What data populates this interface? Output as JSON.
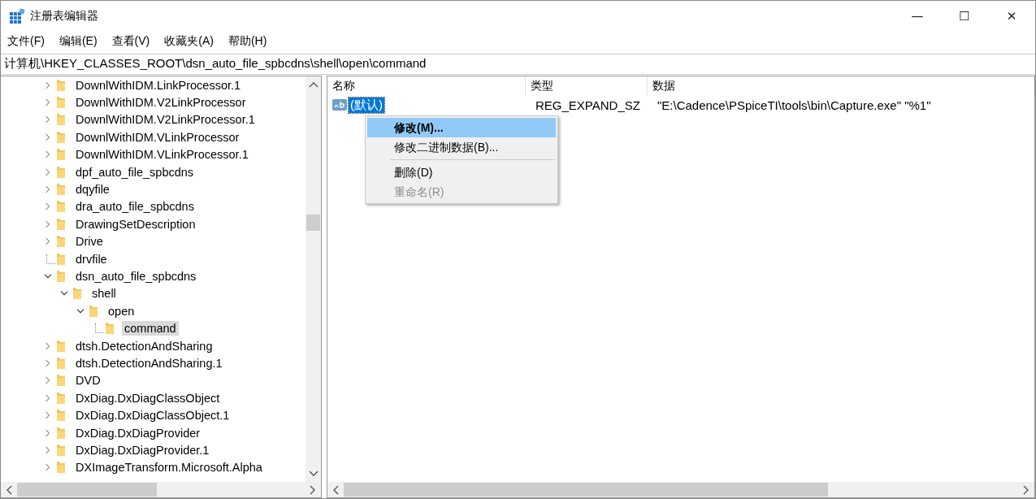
{
  "window": {
    "title": "注册表编辑器",
    "controls": [
      "—",
      "☐",
      "✕"
    ]
  },
  "menu": [
    "文件(F)",
    "编辑(E)",
    "查看(V)",
    "收藏夹(A)",
    "帮助(H)"
  ],
  "address": "计算机\\HKEY_CLASSES_ROOT\\dsn_auto_file_spbcdns\\shell\\open\\command",
  "tree": [
    {
      "label": "DownlWithIDM.LinkProcessor.1",
      "kind": "collapsed",
      "selected": false
    },
    {
      "label": "DownlWithIDM.V2LinkProcessor",
      "kind": "collapsed",
      "selected": false
    },
    {
      "label": "DownlWithIDM.V2LinkProcessor.1",
      "kind": "collapsed",
      "selected": false
    },
    {
      "label": "DownlWithIDM.VLinkProcessor",
      "kind": "collapsed",
      "selected": false
    },
    {
      "label": "DownlWithIDM.VLinkProcessor.1",
      "kind": "collapsed",
      "selected": false
    },
    {
      "label": "dpf_auto_file_spbcdns",
      "kind": "collapsed",
      "selected": false
    },
    {
      "label": "dqyfile",
      "kind": "collapsed",
      "selected": false
    },
    {
      "label": "dra_auto_file_spbcdns",
      "kind": "collapsed",
      "selected": false
    },
    {
      "label": "DrawingSetDescription",
      "kind": "collapsed",
      "selected": false
    },
    {
      "label": "Drive",
      "kind": "collapsed",
      "selected": false
    },
    {
      "label": "drvfile",
      "kind": "leaf",
      "selected": false
    },
    {
      "label": "dsn_auto_file_spbcdns",
      "kind": "expanded",
      "selected": false,
      "children": [
        {
          "label": "shell",
          "kind": "expanded",
          "selected": false,
          "children": [
            {
              "label": "open",
              "kind": "expanded",
              "selected": false,
              "children": [
                {
                  "label": "command",
                  "kind": "leaf",
                  "selected": true
                }
              ]
            }
          ]
        }
      ]
    },
    {
      "label": "dtsh.DetectionAndSharing",
      "kind": "collapsed",
      "selected": false
    },
    {
      "label": "dtsh.DetectionAndSharing.1",
      "kind": "collapsed",
      "selected": false
    },
    {
      "label": "DVD",
      "kind": "collapsed",
      "selected": false
    },
    {
      "label": "DxDiag.DxDiagClassObject",
      "kind": "collapsed",
      "selected": false
    },
    {
      "label": "DxDiag.DxDiagClassObject.1",
      "kind": "collapsed",
      "selected": false
    },
    {
      "label": "DxDiag.DxDiagProvider",
      "kind": "collapsed",
      "selected": false
    },
    {
      "label": "DxDiag.DxDiagProvider.1",
      "kind": "collapsed",
      "selected": false
    },
    {
      "label": "DXImageTransform.Microsoft.Alpha",
      "kind": "collapsed",
      "selected": false
    }
  ],
  "columns": [
    "名称",
    "类型",
    "数据"
  ],
  "values": [
    {
      "name": "(默认)",
      "type": "REG_EXPAND_SZ",
      "data": "\"E:\\Cadence\\PSpiceTI\\tools\\bin\\Capture.exe\" \"%1\"",
      "selected": true
    }
  ],
  "context_menu": [
    {
      "label": "修改(M)...",
      "kind": "item",
      "selected": true,
      "disabled": false,
      "bold": true
    },
    {
      "label": "修改二进制数据(B)...",
      "kind": "item",
      "selected": false,
      "disabled": false,
      "bold": false
    },
    {
      "kind": "separator"
    },
    {
      "label": "删除(D)",
      "kind": "item",
      "selected": false,
      "disabled": false,
      "bold": false
    },
    {
      "label": "重命名(R)",
      "kind": "item",
      "selected": false,
      "disabled": true,
      "bold": false
    }
  ]
}
